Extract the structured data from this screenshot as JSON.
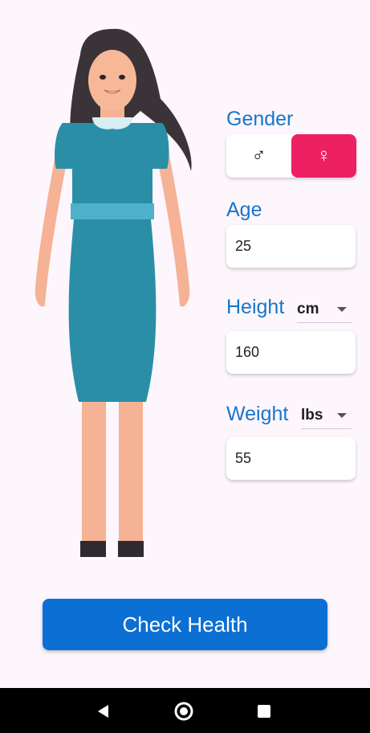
{
  "gender": {
    "label": "Gender",
    "male_symbol": "♂",
    "female_symbol": "♀",
    "selected": "female"
  },
  "age": {
    "label": "Age",
    "value": "25"
  },
  "height": {
    "label": "Height",
    "unit": "cm",
    "value": "160"
  },
  "weight": {
    "label": "Weight",
    "unit": "lbs",
    "value": "55"
  },
  "check_button": {
    "label": "Check Health"
  },
  "nav": {
    "icons": [
      "back-icon",
      "home-icon",
      "recents-icon"
    ]
  },
  "colors": {
    "background": "#fdf6fd",
    "label_blue": "#1976c9",
    "female_pink": "#ec2063",
    "cta_blue": "#0b6fd3",
    "dress_teal": "#2a8fa6"
  }
}
